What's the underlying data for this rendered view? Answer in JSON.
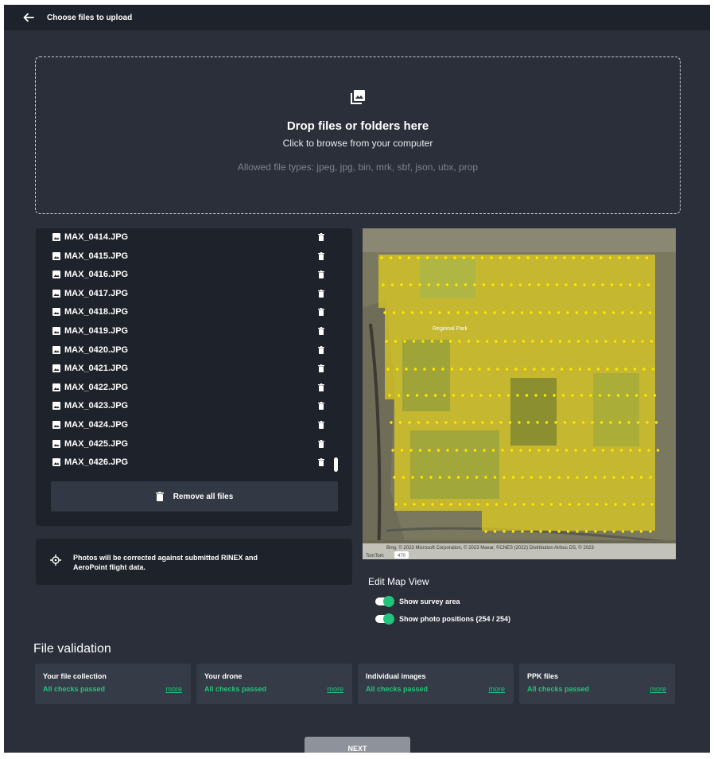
{
  "header": {
    "title": "Choose files to upload",
    "back_icon": "arrow-left-icon"
  },
  "dropzone": {
    "icon": "photo-library-icon",
    "heading": "Drop files or folders here",
    "subtext": "Click to browse from your computer",
    "allowed_types": "Allowed file types: jpeg, jpg, bin, mrk, sbf, json, ubx, prop"
  },
  "files": [
    "MAX_0414.JPG",
    "MAX_0415.JPG",
    "MAX_0416.JPG",
    "MAX_0417.JPG",
    "MAX_0418.JPG",
    "MAX_0419.JPG",
    "MAX_0420.JPG",
    "MAX_0421.JPG",
    "MAX_0422.JPG",
    "MAX_0423.JPG",
    "MAX_0424.JPG",
    "MAX_0425.JPG",
    "MAX_0426.JPG"
  ],
  "remove_all_label": "Remove all files",
  "info": {
    "icon": "crosshair-icon",
    "text": "Photos will be corrected against submitted RINEX and AeroPoint flight data."
  },
  "map": {
    "park_label": "Regional Park",
    "attribution": "Bing, © 2023 Microsoft Corporation, © 2023 Maxar, ©CNES (2022) Distribution Airbus DS, © 2023",
    "attribution2": "TomTom",
    "road_label": "470",
    "survey_color": "#e6d21c",
    "point_color": "#ffe600"
  },
  "map_controls": {
    "title": "Edit Map View",
    "toggles": [
      {
        "label": "Show survey area",
        "on": true
      },
      {
        "label": "Show photo positions (254 / 254)",
        "on": true
      }
    ]
  },
  "validation": {
    "title": "File validation",
    "cards": [
      {
        "title": "Your file collection",
        "status": "All checks passed",
        "more": "more"
      },
      {
        "title": "Your drone",
        "status": "All checks passed",
        "more": "more"
      },
      {
        "title": "Individual images",
        "status": "All checks passed",
        "more": "more"
      },
      {
        "title": "PPK files",
        "status": "All checks passed",
        "more": "more"
      }
    ]
  },
  "next_label": "NEXT",
  "colors": {
    "accent": "#21c47a",
    "background": "#2a2f3a",
    "panel": "#1e222a"
  }
}
